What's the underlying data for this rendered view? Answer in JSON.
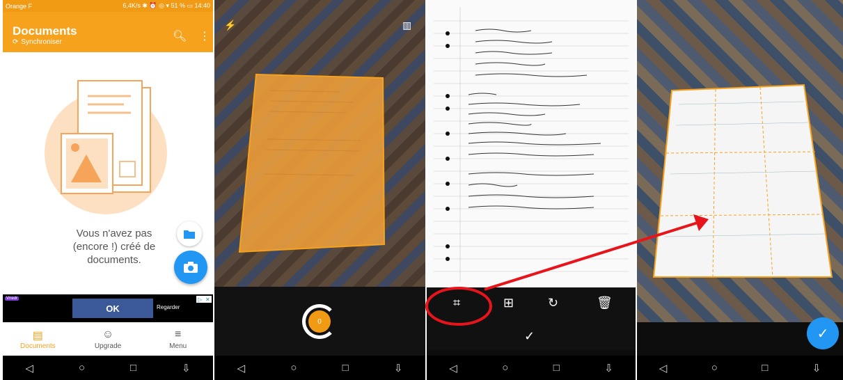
{
  "statusbar": {
    "carrier": "Orange F",
    "right": "6,4K/s ✱ ⏰ ◎ ▾ 51 % ▭ 14:40"
  },
  "appbar": {
    "title": "Documents",
    "sync_label": "Synchroniser"
  },
  "empty_state": {
    "line1": "Vous n'avez pas",
    "line2": "(encore !) créé de",
    "line3": "documents."
  },
  "ad": {
    "brand": "Vnedr",
    "ok_label": "OK",
    "watch_label": "Regarder"
  },
  "bottom_nav": [
    {
      "label": "Documents",
      "icon": "documents-icon"
    },
    {
      "label": "Upgrade",
      "icon": "smiley-icon"
    },
    {
      "label": "Menu",
      "icon": "menu-icon"
    }
  ],
  "camera": {
    "counter": "0"
  },
  "sysnav": {
    "back": "◁",
    "home": "○",
    "recent": "□",
    "drawer": "⇩"
  },
  "colors": {
    "accent": "#f7a21c",
    "blue": "#2196f3",
    "annotation": "#e8141c"
  }
}
